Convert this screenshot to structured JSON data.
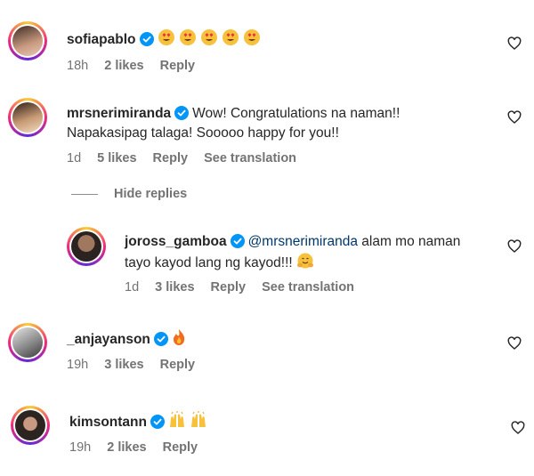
{
  "comments": [
    {
      "username": "sofiapablo",
      "text": "",
      "emojis": [
        "heart-eyes",
        "heart-eyes",
        "heart-eyes",
        "heart-eyes",
        "heart-eyes"
      ],
      "time": "18h",
      "likes": "2 likes",
      "reply": "Reply"
    },
    {
      "username": "mrsnerimiranda",
      "text_line1": "Wow! Congratulations na naman!!",
      "text_line2": "Napakasipag talaga! Sooooo happy for you!!",
      "time": "1d",
      "likes": "5 likes",
      "reply": "Reply",
      "translation": "See translation"
    },
    {
      "username": "joross_gamboa",
      "mention": "@mrsnerimiranda",
      "text_line1": " alam mo naman",
      "text_line2": "tayo kayod lang ng kayod!!!",
      "emoji": "hugging",
      "time": "1d",
      "likes": "3 likes",
      "reply": "Reply",
      "translation": "See translation"
    },
    {
      "username": "_anjayanson",
      "emoji": "fire",
      "time": "19h",
      "likes": "3 likes",
      "reply": "Reply"
    },
    {
      "username": "kimsontann",
      "emojis": [
        "raised-hands",
        "raised-hands"
      ],
      "time": "19h",
      "likes": "2 likes",
      "reply": "Reply"
    }
  ],
  "hide_replies": "Hide replies",
  "colors": {
    "verified": "#0095f6",
    "meta": "#737373",
    "mention": "#00376b"
  }
}
